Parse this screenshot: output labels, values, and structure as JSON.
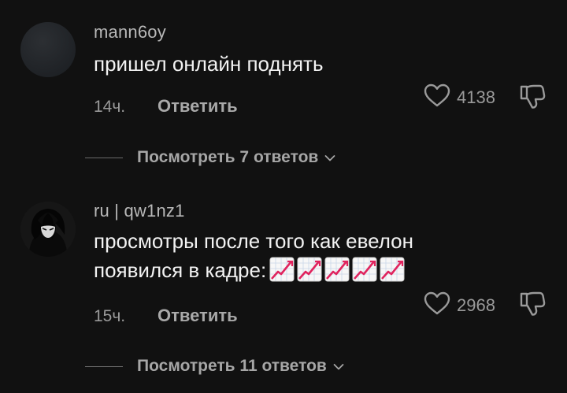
{
  "comments": [
    {
      "username": "mann6oy",
      "text": "пришел онлайн поднять",
      "time": "14ч.",
      "reply_label": "Ответить",
      "likes": "4138",
      "view_replies": "Посмотреть 7 ответов",
      "avatar": "dark-gray-default-avatar"
    },
    {
      "username": "ru | qw1nz1",
      "text_line1": "просмотры после того как евелон",
      "text_line2": "появился в кадре:",
      "emojis": [
        "chart-increasing-emoji",
        "chart-increasing-emoji",
        "chart-increasing-emoji",
        "chart-increasing-emoji",
        "chart-increasing-emoji"
      ],
      "time": "15ч.",
      "reply_label": "Ответить",
      "likes": "2968",
      "view_replies": "Посмотреть 11 ответов",
      "avatar": "dark-anime-character-avatar"
    }
  ],
  "colors": {
    "background": "#111111",
    "username": "#b8b8b8",
    "text": "#f2f2f2",
    "meta": "#9a9a9a",
    "emoji_line": "#e0245e"
  }
}
